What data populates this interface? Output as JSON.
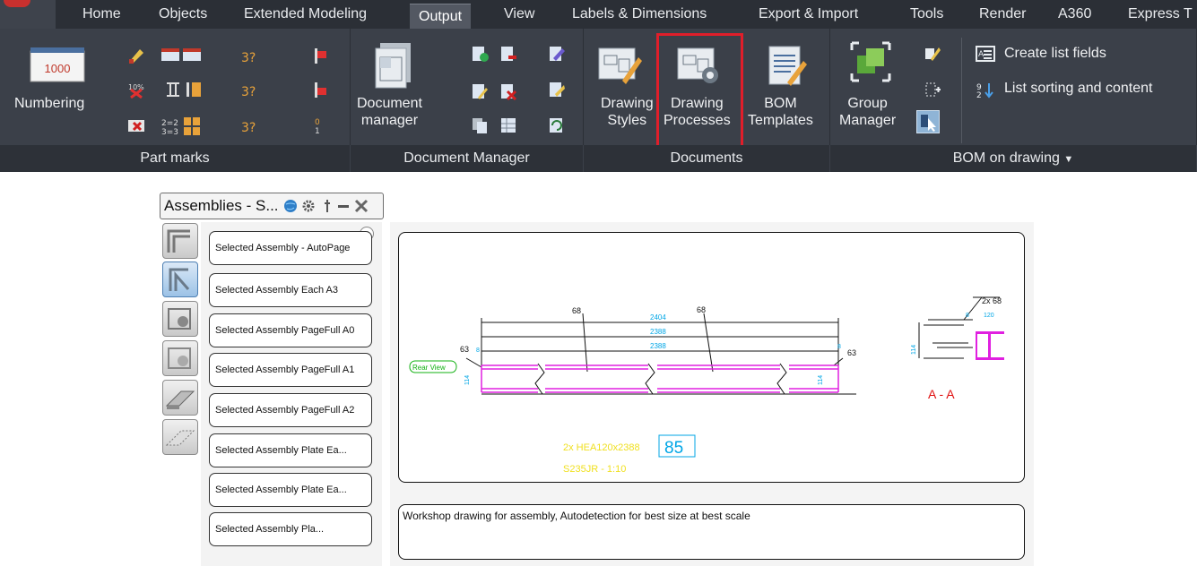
{
  "ribbon": {
    "tabs": [
      "Home",
      "Objects",
      "Extended Modeling",
      "Output",
      "View",
      "Labels & Dimensions",
      "Export & Import",
      "Tools",
      "Render",
      "A360",
      "Express T"
    ],
    "active_tab": "Output",
    "panels": {
      "part_marks": {
        "title": "Part marks",
        "numbering_label": "Numbering",
        "numbering_icon_value": "1000"
      },
      "document_manager": {
        "title": "Document Manager",
        "doc_manager_label_1": "Document",
        "doc_manager_label_2": "manager"
      },
      "documents": {
        "title": "Documents",
        "drawing_styles_1": "Drawing",
        "drawing_styles_2": "Styles",
        "drawing_processes_1": "Drawing",
        "drawing_processes_2": "Processes",
        "bom_templates_1": "BOM",
        "bom_templates_2": "Templates"
      },
      "bom_on_drawing": {
        "title": "BOM on drawing",
        "group_manager_1": "Group",
        "group_manager_2": "Manager",
        "create_list_fields": "Create list fields",
        "list_sorting": "List sorting and content"
      }
    }
  },
  "palette": {
    "title": "Assemblies - S...",
    "items": [
      "Selected Assembly - AutoPage",
      "Selected Assembly Each A3",
      "Selected Assembly PageFull A0",
      "Selected Assembly PageFull A1",
      "Selected Assembly PageFull A2",
      "Selected Assembly Plate Ea...",
      "Selected Assembly Plate Ea...",
      "Selected Assembly Pla..."
    ],
    "description": "Workshop drawing for assembly, Autodetection for best size at best scale"
  },
  "drawing": {
    "dim_total": "2404",
    "dim_1": "2388",
    "dim_2": "2388",
    "mark_68_left": "68",
    "mark_68_right": "68",
    "mark_63_left": "63",
    "mark_63_right": "63",
    "dim_8_left": "8",
    "dim_8_right": "8",
    "height_114": "114",
    "view_label": "Rear View",
    "section_label": "A - A",
    "section_mark": "2x 68",
    "section_dim_8": "8",
    "section_dim_120": "120",
    "section_height": "114",
    "part_desc": "2x HEA120x2388",
    "part_number": "85",
    "material_scale": "S235JR - 1:10"
  },
  "colors": {
    "ribbon_bg": "#3b4049",
    "tabbar_bg": "#2b2f36",
    "highlight": "#e01e2a",
    "dim_cyan": "#00a6e6",
    "beam_magenta": "#e020e0",
    "label_yellow": "#f0e020",
    "section_red": "#e01010",
    "view_green": "#10b010"
  }
}
